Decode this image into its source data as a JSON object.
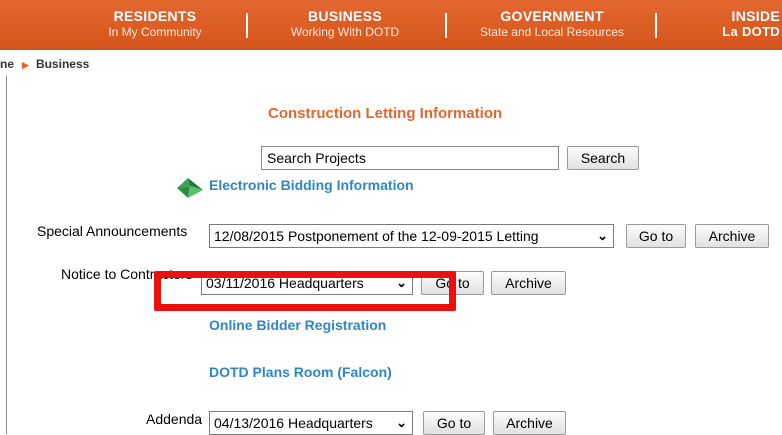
{
  "nav": [
    {
      "main": "RESIDENTS",
      "sub": "In My Community"
    },
    {
      "main": "BUSINESS",
      "sub": "Working With DOTD"
    },
    {
      "main": "GOVERNMENT",
      "sub": "State and Local Resources"
    },
    {
      "main": "INSIDE",
      "sub": "La DOTD"
    }
  ],
  "breadcrumb": {
    "home": "ne",
    "current": "Business"
  },
  "page_title": "Construction Letting Information",
  "search": {
    "value": "Search Projects",
    "button": "Search"
  },
  "links": {
    "electronic_bidding": "Electronic Bidding Information",
    "online_bidder": "Online Bidder Registration",
    "plans_room": "DOTD Plans Room (Falcon)"
  },
  "special": {
    "label": "Special Announcements",
    "selected": "12/08/2015 Postponement of the 12-09-2015 Letting",
    "goto": "Go to",
    "archive": "Archive"
  },
  "notice": {
    "label": "Notice to Contractors",
    "selected": "03/11/2016 Headquarters",
    "goto": "Go to",
    "archive": "Archive"
  },
  "addenda": {
    "label": "Addenda",
    "selected": "04/13/2016 Headquarters",
    "goto": "Go to",
    "archive": "Archive"
  },
  "colors": {
    "nav": "#d5551c",
    "title": "#e2672f",
    "link": "#2e86c9",
    "highlight": "#ee0f0f"
  }
}
